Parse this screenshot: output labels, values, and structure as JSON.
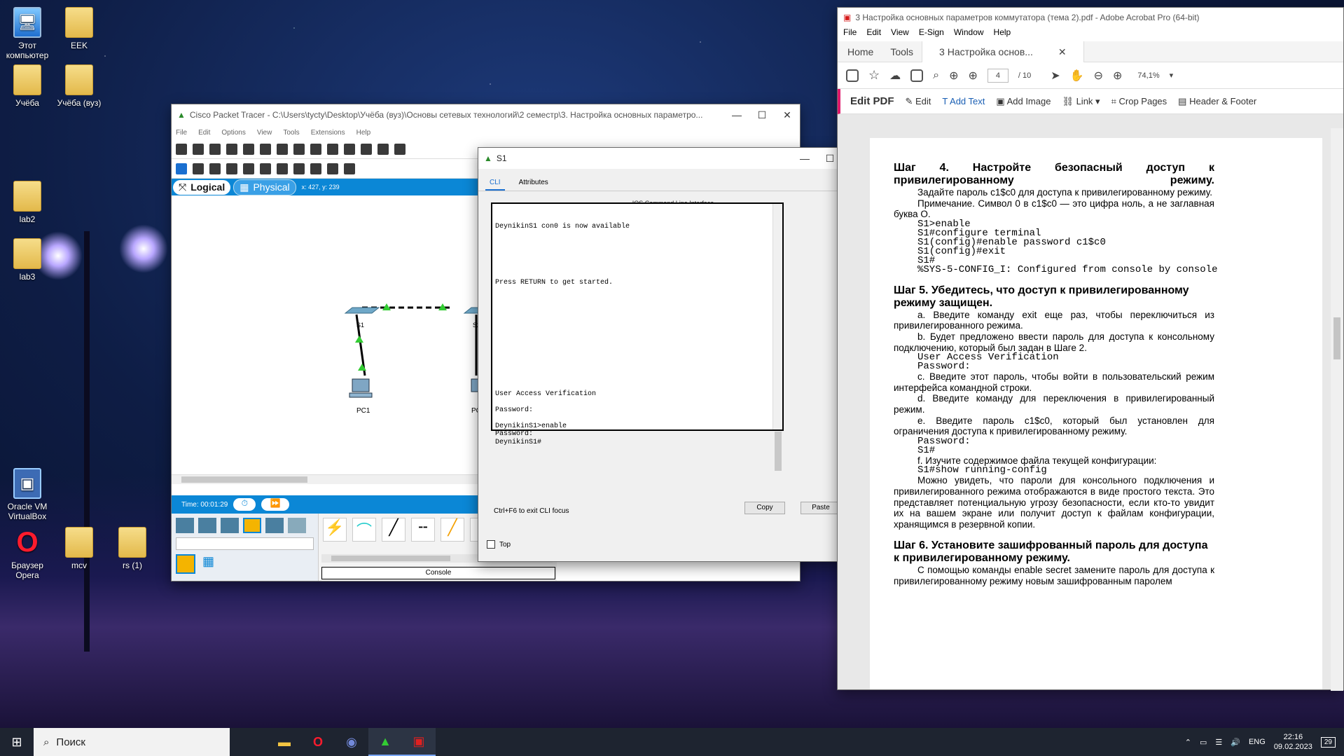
{
  "desktop": {
    "icons": [
      {
        "label": "Этот\nкомпьютер"
      },
      {
        "label": "EEK"
      },
      {
        "label": "Учёба"
      },
      {
        "label": "Учёба (вуз)"
      },
      {
        "label": "lab2"
      },
      {
        "label": "lab3"
      },
      {
        "label": "Oracle VM\nVirtualBox"
      },
      {
        "label": "Браузер\nOpera"
      },
      {
        "label": "mcv"
      },
      {
        "label": "rs (1)"
      }
    ]
  },
  "packet_tracer": {
    "title": "Cisco Packet Tracer - C:\\Users\\tycty\\Desktop\\Учёба (вуз)\\Основы сетевых технологий\\2 семестр\\3. Настройка основных параметро...",
    "menu": [
      "File",
      "Edit",
      "Options",
      "View",
      "Tools",
      "Extensions",
      "Help"
    ],
    "tab_logical": "Logical",
    "tab_physical": "Physical",
    "coords": "x: 427, y: 239",
    "devices": {
      "s1": "S1",
      "s2": "S2",
      "pc1": "PC1",
      "pc2": "PC"
    },
    "time": "Time: 00:01:29",
    "console_label": "Console"
  },
  "s1_window": {
    "title": "S1",
    "tabs": [
      "CLI",
      "Attributes"
    ],
    "header": "IOS Command Line Interface",
    "terminal": "DeynikinS1 con0 is now available\n\n\n\n\n\n\nPress RETURN to get started.\n\n\n\n\n\n\n\n\n\n\n\n\n\nUser Access Verification\n\nPassword:\n\nDeynikinS1>enable\nPassword:\nDeynikinS1#",
    "hint": "Ctrl+F6 to exit CLI focus",
    "copy": "Copy",
    "paste": "Paste",
    "top": "Top"
  },
  "acrobat": {
    "title": "3 Настройка основных параметров коммутатора (тема 2).pdf - Adobe Acrobat Pro (64-bit)",
    "menu": [
      "File",
      "Edit",
      "View",
      "E-Sign",
      "Window",
      "Help"
    ],
    "tab_home": "Home",
    "tab_tools": "Tools",
    "tab_doc": "3 Настройка основ...",
    "page_current": "4",
    "page_total": "/ 10",
    "zoom": "74,1%",
    "edit_tools": [
      "Edit PDF",
      "Edit",
      "Add Text",
      "Add Image",
      "Link",
      "Crop Pages",
      "Header & Footer"
    ],
    "content": {
      "h4": "Шаг 4. Настройте безопасный доступ к привилегированному режиму.",
      "p1": "Задайте пароль c1$c0 для доступа к привилегированному режиму.",
      "p2": "Примечание. Символ 0 в c1$c0 — это цифра ноль, а не заглавная буква О.",
      "code1": "S1>enable\nS1#configure terminal\nS1(config)#enable password c1$c0\nS1(config)#exit\nS1#\n%SYS-5-CONFIG_I: Configured from console by console",
      "h5": "Шаг 5. Убедитесь, что доступ к привилегированному режиму защищен.",
      "a": "a. Введите команду exit еще раз, чтобы переключиться из привилегированного режима.",
      "b": "b. Будет предложено ввести пароль для доступа к консольному подключению, который был задан в Шаге 2.",
      "code2": "User Access Verification\nPassword:",
      "c": "c. Введите этот пароль, чтобы войти в пользовательский режим интерфейса командной строки.",
      "d": "d. Введите команду для переключения в привилегированный режим.",
      "e": "e. Введите пароль c1$c0, который был установлен для ограничения доступа к привилегированному режиму.",
      "code3": "Password:\nS1#",
      "f": "f. Изучите содержимое файла текущей конфигурации:",
      "code4": "S1#show running-config",
      "p3": "Можно увидеть, что пароли для консольного подключения и привилегированного режима отображаются в виде простого текста. Это представляет потенциальную угрозу безопасности, если кто-то увидит их на вашем экране или получит доступ к файлам конфигурации, хранящимся в резервной копии.",
      "h6": "Шаг 6. Установите зашифрованный пароль для доступа к привилегированному режиму.",
      "p4": "С помощью команды enable secret замените пароль для доступа к привилегированному режиму новым зашифрованным паролем"
    }
  },
  "taskbar": {
    "search": "Поиск",
    "lang": "ENG",
    "time": "22:16",
    "date": "09.02.2023",
    "notif": "29"
  }
}
